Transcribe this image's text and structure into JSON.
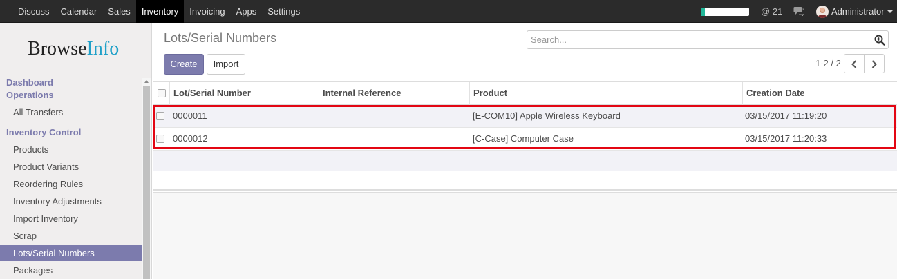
{
  "topbar": {
    "menu": [
      "Discuss",
      "Calendar",
      "Sales",
      "Inventory",
      "Invoicing",
      "Apps",
      "Settings"
    ],
    "active_menu": "Inventory",
    "progress_fraction": 0.08,
    "progress_color": "#21b799",
    "mentions_label": "@",
    "mentions_count": "21",
    "user": "Administrator"
  },
  "sidebar": {
    "logo_part1": "Browse",
    "logo_part2": "Info",
    "heading_dashboard": "Dashboard",
    "heading_operations": "Operations",
    "operations_items": [
      "All Transfers"
    ],
    "heading_inventory_control": "Inventory Control",
    "inventory_items": [
      "Products",
      "Product Variants",
      "Reordering Rules",
      "Inventory Adjustments",
      "Import Inventory",
      "Scrap",
      "Lots/Serial Numbers",
      "Packages"
    ],
    "active_item": "Lots/Serial Numbers"
  },
  "control": {
    "title": "Lots/Serial Numbers",
    "search_placeholder": "Search...",
    "create_label": "Create",
    "import_label": "Import",
    "pager": "1-2 / 2"
  },
  "table": {
    "columns": [
      "Lot/Serial Number",
      "Internal Reference",
      "Product",
      "Creation Date"
    ],
    "rows": [
      {
        "lot": "0000011",
        "ref": "",
        "product": "[E-COM10] Apple Wireless Keyboard",
        "date": "03/15/2017 11:19:20"
      },
      {
        "lot": "0000012",
        "ref": "",
        "product": "[C-Case] Computer Case",
        "date": "03/15/2017 11:20:33"
      }
    ]
  },
  "colors": {
    "brand": "#7c7bad",
    "highlight": "#e30613",
    "logo_accent": "#1fa0c8"
  }
}
